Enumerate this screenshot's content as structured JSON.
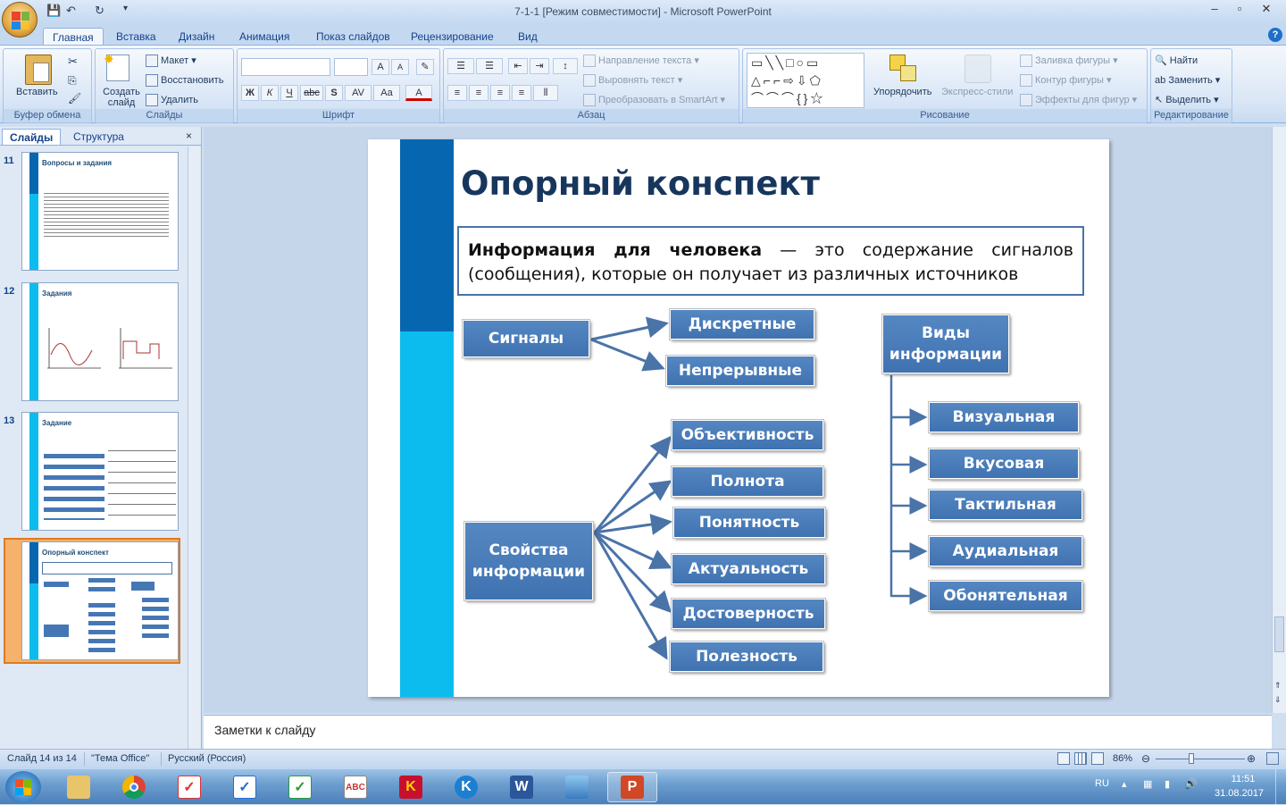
{
  "window": {
    "title": "7-1-1 [Режим совместимости] - Microsoft PowerPoint"
  },
  "tabs": [
    "Главная",
    "Вставка",
    "Дизайн",
    "Анимация",
    "Показ слайдов",
    "Рецензирование",
    "Вид"
  ],
  "ribbon": {
    "clipboard": {
      "paste": "Вставить",
      "label": "Буфер обмена"
    },
    "slides": {
      "new_slide": "Создать слайд",
      "layout": "Макет",
      "reset": "Восстановить",
      "delete": "Удалить",
      "label": "Слайды"
    },
    "font": {
      "label": "Шрифт",
      "bold": "Ж",
      "italic": "К",
      "underline": "Ч",
      "strike": "abc",
      "shadow": "S",
      "spacing": "AV",
      "case": "Aa",
      "color": "A",
      "grow": "A",
      "shrink": "A"
    },
    "paragraph": {
      "text_dir": "Направление текста",
      "align_text": "Выровнять текст",
      "smartart": "Преобразовать в SmartArt",
      "label": "Абзац"
    },
    "drawing": {
      "arrange": "Упорядочить",
      "quick_styles": "Экспресс-стили",
      "fill": "Заливка фигуры",
      "outline": "Контур фигуры",
      "effects": "Эффекты для фигур",
      "label": "Рисование"
    },
    "editing": {
      "find": "Найти",
      "replace": "Заменить",
      "select": "Выделить",
      "label": "Редактирование"
    }
  },
  "panel": {
    "tab_slides": "Слайды",
    "tab_outline": "Структура",
    "thumbs": [
      {
        "num": "11",
        "title": "Вопросы и задания"
      },
      {
        "num": "12",
        "title": "Задания"
      },
      {
        "num": "13",
        "title": "Задание"
      },
      {
        "num": "14",
        "title": "Опорный конспект"
      }
    ]
  },
  "slide": {
    "title": "Опорный конспект",
    "definition_term": "Информация для человека",
    "definition_rest": " — это содержание сигналов (сообщения), которые он получает из различных источников",
    "signals": "Сигналы",
    "discrete": "Дискретные",
    "continuous": "Непрерывные",
    "types": "Виды информации",
    "type_items": [
      "Визуальная",
      "Вкусовая",
      "Тактильная",
      "Аудиальная",
      "Обонятельная"
    ],
    "properties": "Свойства информации",
    "property_items": [
      "Объективность",
      "Полнота",
      "Понятность",
      "Актуальность",
      "Достоверность",
      "Полезность"
    ]
  },
  "notes": {
    "placeholder": "Заметки к слайду"
  },
  "status": {
    "slide_info": "Слайд 14 из 14",
    "theme": "\"Тема Office\"",
    "language": "Русский (Россия)",
    "zoom": "86%"
  },
  "tray": {
    "lang": "RU",
    "time": "11:51",
    "date": "31.08.2017"
  }
}
